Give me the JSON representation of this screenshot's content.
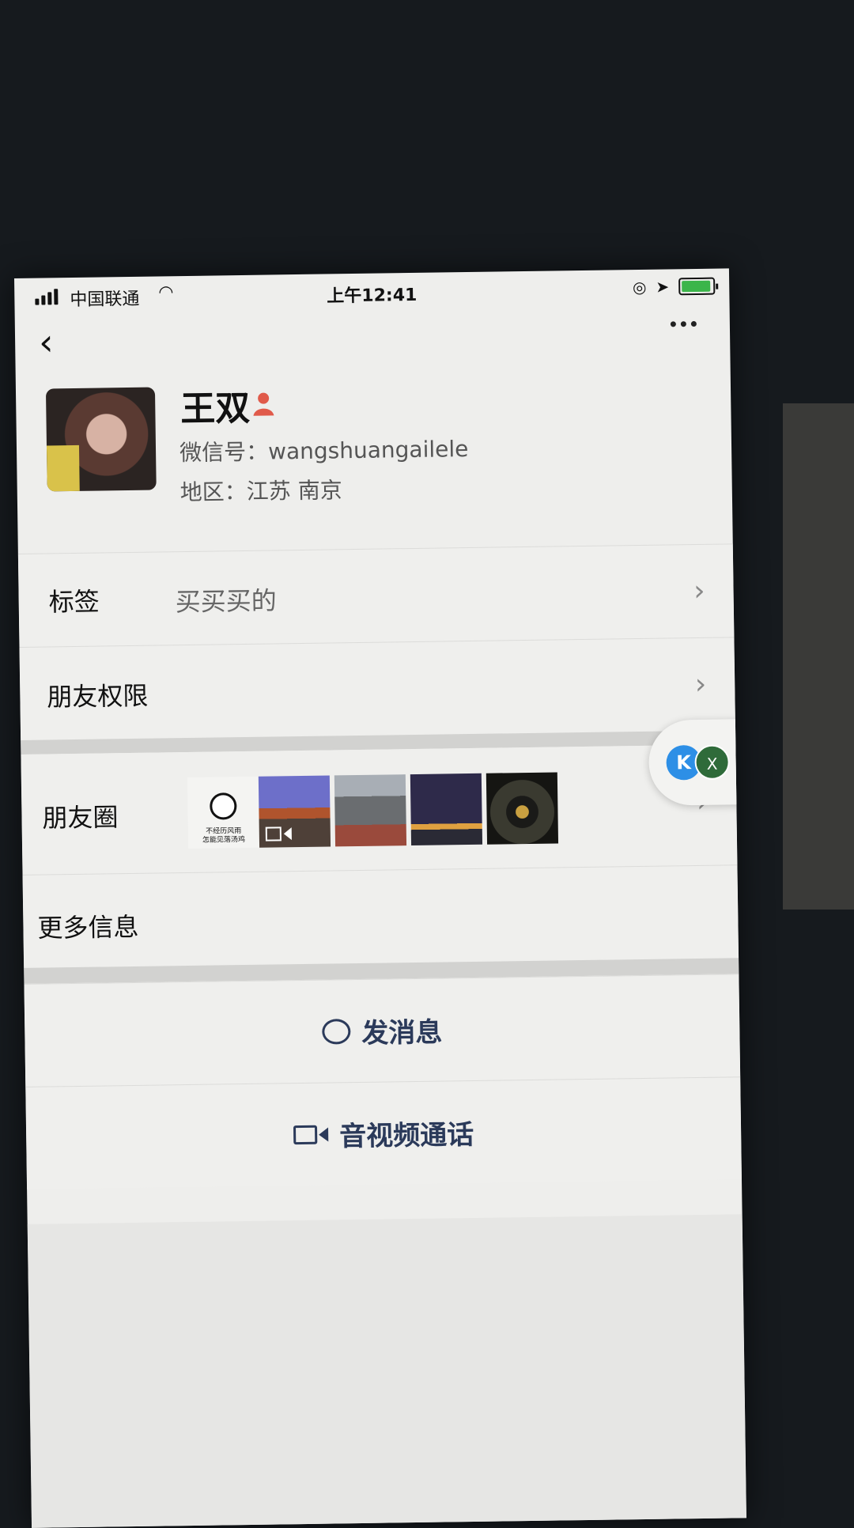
{
  "status_bar": {
    "carrier": "中国联通",
    "time": "上午12:41",
    "battery_level": 0.85
  },
  "profile": {
    "name": "王双",
    "wechat_id": "微信号：wangshuangailele",
    "region": "地区：江苏 南京"
  },
  "rows": {
    "tags_label": "标签",
    "tags_value": "买买买的",
    "permissions_label": "朋友权限",
    "moments_label": "朋友圈",
    "more_info_label": "更多信息"
  },
  "moments_meme_text": "不经历风雨\n怎能见落汤鸡",
  "floater": {
    "left_glyph": "K",
    "right_glyph": "X"
  },
  "actions": {
    "message_label": "发消息",
    "call_label": "音视频通话"
  },
  "colors": {
    "accent_text": "#2b3a5a",
    "person_icon": "#e05a4a",
    "battery_fill": "#3bb54a"
  }
}
